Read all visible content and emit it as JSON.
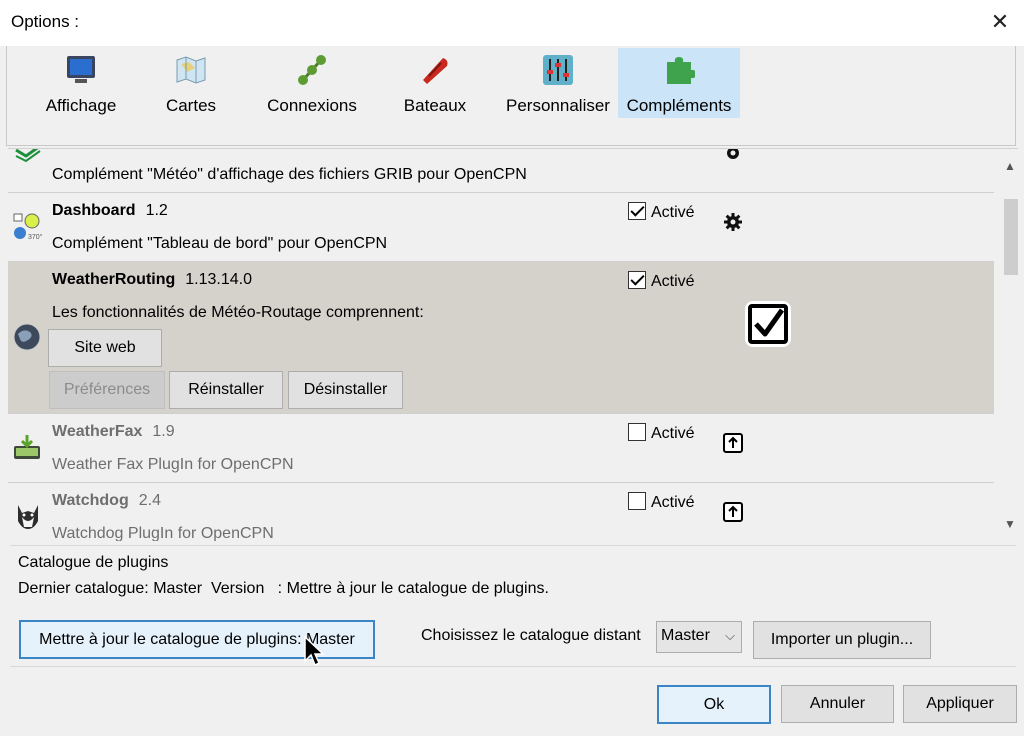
{
  "window": {
    "title": "Options :"
  },
  "tabs": [
    {
      "label": "Affichage"
    },
    {
      "label": "Cartes"
    },
    {
      "label": "Connexions"
    },
    {
      "label": "Bateaux"
    },
    {
      "label": "Personnaliser"
    },
    {
      "label": "Compléments"
    }
  ],
  "plugins": [
    {
      "name": "",
      "version": "",
      "description": "Complément \"Météo\" d'affichage des fichiers GRIB pour OpenCPN"
    },
    {
      "name": "Dashboard",
      "version": "1.2",
      "description": "Complément \"Tableau de bord\" pour OpenCPN",
      "enabled_label": "Activé",
      "enabled": true
    },
    {
      "name": "WeatherRouting",
      "version": "1.13.14.0",
      "description": "Les fonctionnalités de Météo-Routage comprennent:",
      "enabled_label": "Activé",
      "enabled": true,
      "buttons": {
        "website": "Site web",
        "preferences": "Préférences",
        "reinstall": "Réinstaller",
        "uninstall": "Désinstaller"
      }
    },
    {
      "name": "WeatherFax",
      "version": "1.9",
      "description": "Weather Fax PlugIn for OpenCPN",
      "enabled_label": "Activé",
      "enabled": false
    },
    {
      "name": "Watchdog",
      "version": "2.4",
      "description": "Watchdog PlugIn for OpenCPN",
      "enabled_label": "Activé",
      "enabled": false
    }
  ],
  "catalog": {
    "legend": "Catalogue de plugins",
    "info": "Dernier catalogue: Master  Version   : Mettre à jour le catalogue de plugins.",
    "update_button": "Mettre à jour le catalogue de plugins: Master",
    "choose_label": "Choisissez le catalogue distant",
    "selected": "Master",
    "import_button": "Importer un plugin..."
  },
  "dialog": {
    "ok": "Ok",
    "cancel": "Annuler",
    "apply": "Appliquer"
  },
  "colors": {
    "active_tab": "#cce4f7",
    "selected_row": "#d5d1cb",
    "default_border": "#3a85c6"
  }
}
